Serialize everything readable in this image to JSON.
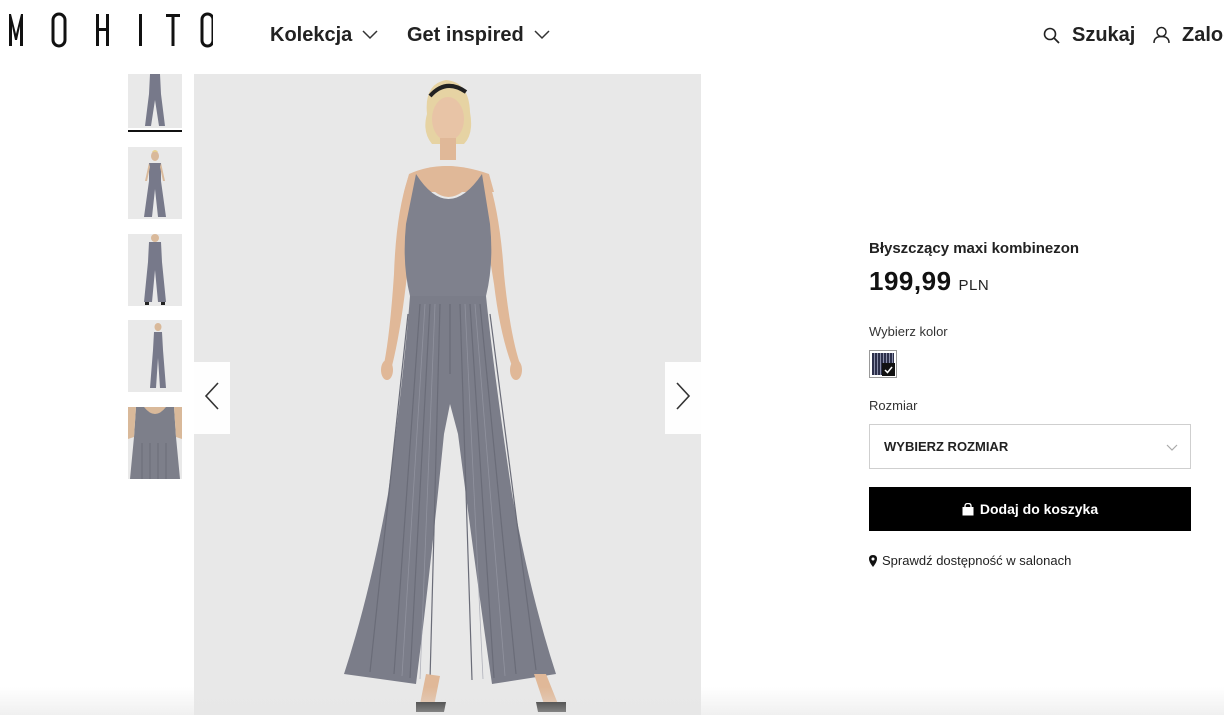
{
  "header": {
    "logo_text": "MOHITO",
    "nav": [
      {
        "label": "Kolekcja"
      },
      {
        "label": "Get inspired"
      }
    ],
    "search_label": "Szukaj",
    "login_label": "Zalog",
    "icons": {
      "chevron": "chevron-down-icon",
      "search": "search-icon",
      "user": "user-icon"
    }
  },
  "gallery": {
    "thumbnail_count": 5,
    "active_index": 0,
    "prev_icon": "chevron-left-icon",
    "next_icon": "chevron-right-icon"
  },
  "product": {
    "name": "Błyszczący maxi kombinezon",
    "price": "199,99",
    "currency": "PLN",
    "color_label": "Wybierz kolor",
    "selected_color": "#2c2f4a",
    "size_label": "Rozmiar",
    "size_select_value": "WYBIERZ ROZMIAR",
    "add_to_cart_label": "Dodaj do koszyka",
    "store_check_label": "Sprawdź dostępność w salonach"
  },
  "colors": {
    "accent": "#000000",
    "fabric": "#7d7f8a",
    "background": "#e8e8e8"
  }
}
